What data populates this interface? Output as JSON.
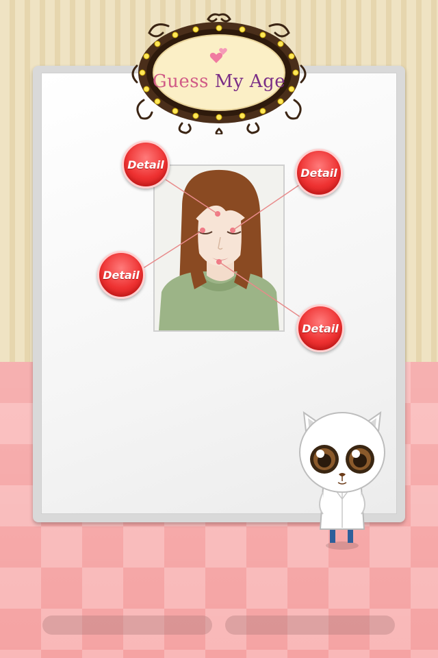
{
  "title": {
    "word1": "Guess",
    "word2": "My Age"
  },
  "buttons": {
    "detail_hair": "Detail",
    "detail_eye": "Detail",
    "detail_cheek": "Detail",
    "detail_chin": "Detail"
  },
  "colors": {
    "detail_red": "#ee3232",
    "title_pink": "#d05a86",
    "title_purple": "#7a2e86",
    "floor_pink": "#f5a3a3"
  }
}
